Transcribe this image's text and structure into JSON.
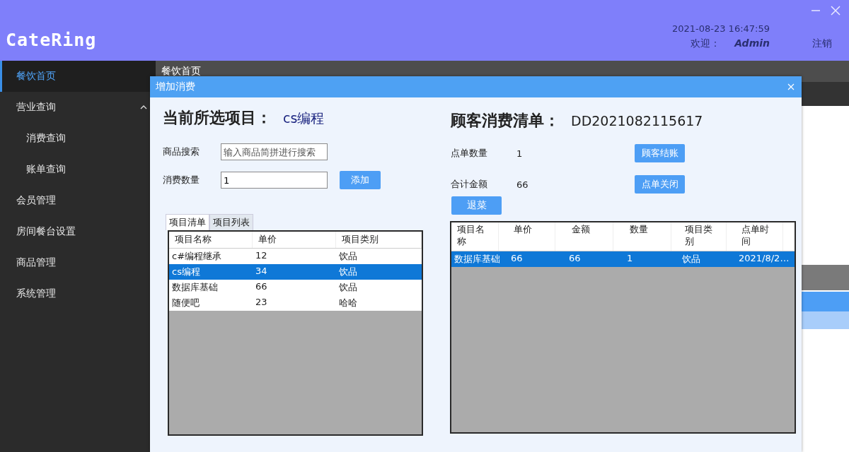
{
  "window": {
    "logo": "CateRing",
    "datetime": "2021-08-23 16:47:59",
    "welcome_label": "欢迎：",
    "user": "Admin",
    "logout": "注销"
  },
  "sidebar": {
    "items": [
      {
        "label": "餐饮首页",
        "selected": true
      },
      {
        "label": "营业查询",
        "selected": false,
        "expanded": true,
        "children": [
          {
            "label": "消费查询",
            "selected": false
          },
          {
            "label": "账单查询",
            "selected": false
          }
        ]
      },
      {
        "label": "会员管理",
        "selected": false
      },
      {
        "label": "房间餐台设置",
        "selected": false
      },
      {
        "label": "商品管理",
        "selected": false
      },
      {
        "label": "系统管理",
        "selected": false
      }
    ]
  },
  "main_tab": {
    "label": "餐饮首页"
  },
  "dialog": {
    "title": "增加消费",
    "selected_item_label": "当前所选项目：",
    "selected_item": "cs编程",
    "search_label": "商品搜索",
    "search": {
      "placeholder": "输入商品简拼进行搜索"
    },
    "quantity_label": "消费数量",
    "quantity": {
      "value": "1"
    },
    "add_button": "添加",
    "tabs": [
      {
        "label": "项目清单",
        "selected": true
      },
      {
        "label": "项目列表",
        "selected": false
      }
    ],
    "items_table": {
      "columns": [
        "项目名称",
        "单价",
        "项目类别"
      ],
      "rows": [
        {
          "cells": [
            "c#编程继承",
            "12",
            "饮品"
          ],
          "selected": false
        },
        {
          "cells": [
            "cs编程",
            "34",
            "饮品"
          ],
          "selected": true
        },
        {
          "cells": [
            "数据库基础",
            "66",
            "饮品"
          ],
          "selected": false
        },
        {
          "cells": [
            "随便吧",
            "23",
            "哈哈"
          ],
          "selected": false
        }
      ]
    },
    "order_label": "顾客消费清单：",
    "order_id": "DD2021082115617",
    "count_label": "点单数量",
    "count": "1",
    "total_label": "合计金额",
    "total": "66",
    "checkout_button": "顾客结账",
    "close_order_button": "点单关闭",
    "remove_button": "退菜",
    "order_table": {
      "columns": [
        "项目名称",
        "单价",
        "金额",
        "数量",
        "项目类别",
        "点单时间"
      ],
      "rows": [
        {
          "cells": [
            "数据库基础",
            "66",
            "66",
            "1",
            "饮品",
            "2021/8/2…"
          ],
          "selected": true
        }
      ]
    }
  }
}
